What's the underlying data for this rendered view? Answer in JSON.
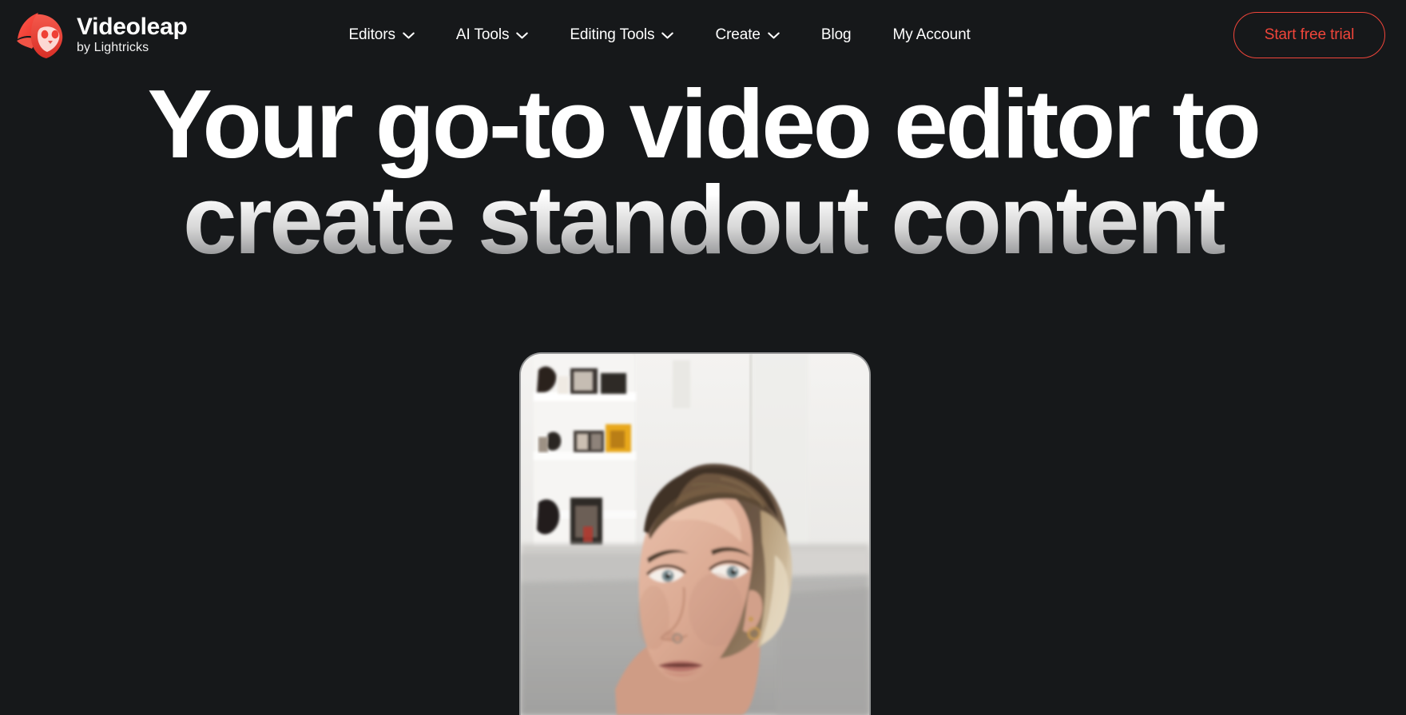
{
  "theme": {
    "background": "#16181a",
    "accent": "#f0453a",
    "text": "#ffffff"
  },
  "header": {
    "brand": {
      "name": "Videoleap",
      "tagline": "by Lightricks",
      "logo_icon": "videoleap-fox-logo-icon"
    },
    "nav": [
      {
        "label": "Editors",
        "has_dropdown": true,
        "icon": "chevron-down-icon"
      },
      {
        "label": "AI Tools",
        "has_dropdown": true,
        "icon": "chevron-down-icon"
      },
      {
        "label": "Editing Tools",
        "has_dropdown": true,
        "icon": "chevron-down-icon"
      },
      {
        "label": "Create",
        "has_dropdown": true,
        "icon": "chevron-down-icon"
      },
      {
        "label": "Blog",
        "has_dropdown": false,
        "icon": ""
      },
      {
        "label": "My Account",
        "has_dropdown": false,
        "icon": ""
      }
    ],
    "cta": {
      "label": "Start free trial",
      "color": "#f0453a"
    }
  },
  "hero": {
    "headline_line1": "Your go-to video editor to",
    "headline_line2": "create standout content",
    "media": {
      "type": "video-preview",
      "name": "hero-video-preview",
      "description": "Portrait video of a woman with short hair in a bright room with white shelves",
      "aspect": "portrait"
    }
  }
}
